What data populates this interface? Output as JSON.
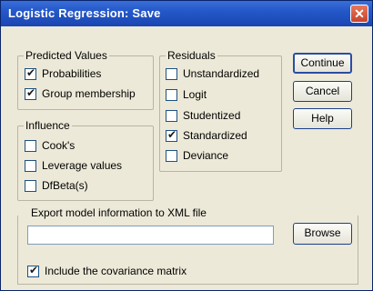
{
  "window": {
    "title": "Logistic Regression: Save",
    "close_label": "✕"
  },
  "predicted": {
    "label": "Predicted Values",
    "items": [
      {
        "label": "Probabilities",
        "checked": true
      },
      {
        "label": "Group membership",
        "checked": true
      }
    ]
  },
  "influence": {
    "label": "Influence",
    "items": [
      {
        "label": "Cook's",
        "checked": false
      },
      {
        "label": "Leverage values",
        "checked": false
      },
      {
        "label": "DfBeta(s)",
        "checked": false
      }
    ]
  },
  "residuals": {
    "label": "Residuals",
    "items": [
      {
        "label": "Unstandardized",
        "checked": false
      },
      {
        "label": "Logit",
        "checked": false
      },
      {
        "label": "Studentized",
        "checked": false
      },
      {
        "label": "Standardized",
        "checked": true
      },
      {
        "label": "Deviance",
        "checked": false
      }
    ]
  },
  "buttons": {
    "continue": "Continue",
    "cancel": "Cancel",
    "help": "Help",
    "browse": "Browse"
  },
  "xml": {
    "label": "Export model information to XML file",
    "value": "",
    "covariance_label": "Include the covariance matrix",
    "covariance_checked": true
  }
}
